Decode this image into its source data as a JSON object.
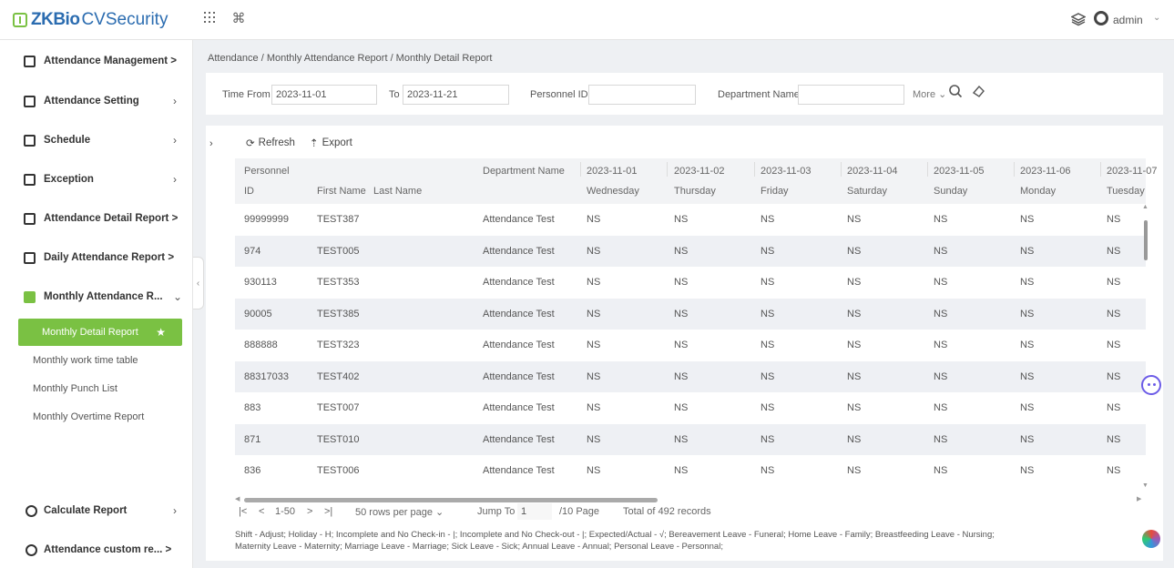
{
  "app": {
    "logo_prefix": "ZKBio",
    "logo_name": "CVSecurity",
    "user": "admin"
  },
  "top_icons": [
    "apps-grid-icon",
    "command-icon",
    "layers-icon",
    "user-icon"
  ],
  "sidebar": {
    "items": [
      {
        "label": "Attendance Management >",
        "icon": "calendar-icon"
      },
      {
        "label": "Attendance Setting",
        "icon": "settings-doc-icon"
      },
      {
        "label": "Schedule",
        "icon": "schedule-icon"
      },
      {
        "label": "Exception",
        "icon": "exception-icon"
      },
      {
        "label": "Attendance Detail Report >",
        "icon": "report-icon"
      },
      {
        "label": "Daily Attendance Report >",
        "icon": "report-icon"
      },
      {
        "label": "Monthly Attendance R...",
        "icon": "report-icon"
      },
      {
        "label": "Calculate Report",
        "icon": "pie-icon"
      },
      {
        "label": "Attendance custom re... >",
        "icon": "pie-icon"
      }
    ],
    "submenu": {
      "active": "Monthly Detail Report",
      "items": [
        "Monthly work time table",
        "Monthly Punch List",
        "Monthly Overtime Report"
      ]
    }
  },
  "breadcrumb": "Attendance / Monthly Attendance Report / Monthly Detail Report",
  "filters": {
    "time_from_label": "Time From",
    "time_from_value": "2023-11-01",
    "to_label": "To",
    "to_value": "2023-11-21",
    "personnel_id_label": "Personnel ID",
    "personnel_id_value": "",
    "department_label": "Department Name",
    "department_value": "",
    "more_label": "More"
  },
  "toolbar": {
    "refresh": "Refresh",
    "export": "Export"
  },
  "table": {
    "header_top": {
      "personnel": "Personnel",
      "department": "Department Name",
      "dates": [
        "2023-11-01",
        "2023-11-02",
        "2023-11-03",
        "2023-11-04",
        "2023-11-05",
        "2023-11-06",
        "2023-11-07"
      ]
    },
    "header_sub": {
      "id": "ID",
      "first_name": "First Name",
      "last_name": "Last Name",
      "days": [
        "Wednesday",
        "Thursday",
        "Friday",
        "Saturday",
        "Sunday",
        "Monday",
        "Tuesday"
      ]
    },
    "rows": [
      {
        "id": "99999999",
        "first": "TEST387",
        "last": "",
        "dept": "Attendance Test",
        "days": [
          "NS",
          "NS",
          "NS",
          "NS",
          "NS",
          "NS",
          "NS"
        ]
      },
      {
        "id": "974",
        "first": "TEST005",
        "last": "",
        "dept": "Attendance Test",
        "days": [
          "NS",
          "NS",
          "NS",
          "NS",
          "NS",
          "NS",
          "NS"
        ]
      },
      {
        "id": "930113",
        "first": "TEST353",
        "last": "",
        "dept": "Attendance Test",
        "days": [
          "NS",
          "NS",
          "NS",
          "NS",
          "NS",
          "NS",
          "NS"
        ]
      },
      {
        "id": "90005",
        "first": "TEST385",
        "last": "",
        "dept": "Attendance Test",
        "days": [
          "NS",
          "NS",
          "NS",
          "NS",
          "NS",
          "NS",
          "NS"
        ]
      },
      {
        "id": "888888",
        "first": "TEST323",
        "last": "",
        "dept": "Attendance Test",
        "days": [
          "NS",
          "NS",
          "NS",
          "NS",
          "NS",
          "NS",
          "NS"
        ]
      },
      {
        "id": "88317033",
        "first": "TEST402",
        "last": "",
        "dept": "Attendance Test",
        "days": [
          "NS",
          "NS",
          "NS",
          "NS",
          "NS",
          "NS",
          "NS"
        ]
      },
      {
        "id": "883",
        "first": "TEST007",
        "last": "",
        "dept": "Attendance Test",
        "days": [
          "NS",
          "NS",
          "NS",
          "NS",
          "NS",
          "NS",
          "NS"
        ]
      },
      {
        "id": "871",
        "first": "TEST010",
        "last": "",
        "dept": "Attendance Test",
        "days": [
          "NS",
          "NS",
          "NS",
          "NS",
          "NS",
          "NS",
          "NS"
        ]
      },
      {
        "id": "836",
        "first": "TEST006",
        "last": "",
        "dept": "Attendance Test",
        "days": [
          "NS",
          "NS",
          "NS",
          "NS",
          "NS",
          "NS",
          "NS"
        ]
      }
    ]
  },
  "pager": {
    "first": "|<",
    "prev": "<",
    "range": "1-50",
    "next": ">",
    "last": ">|",
    "per_page": "50 rows per page",
    "jump_label": "Jump To",
    "jump_value": "1",
    "pages": "/10 Page",
    "total": "Total of 492 records"
  },
  "legend": {
    "line1": "Shift - Adjust;  Holiday - H;  Incomplete and No Check-in - |;  Incomplete and No Check-out - |;  Expected/Actual - √;  Bereavement Leave - Funeral;  Home Leave - Family;  Breastfeeding Leave - Nursing;",
    "line2": "Maternity Leave - Maternity;  Marriage Leave - Marriage;  Sick Leave - Sick;  Annual Leave - Annual;  Personal Leave - Personnal;"
  },
  "colors": {
    "accent": "#7ac143",
    "brand": "#2b6cb0",
    "row_alt": "#eef0f4"
  }
}
